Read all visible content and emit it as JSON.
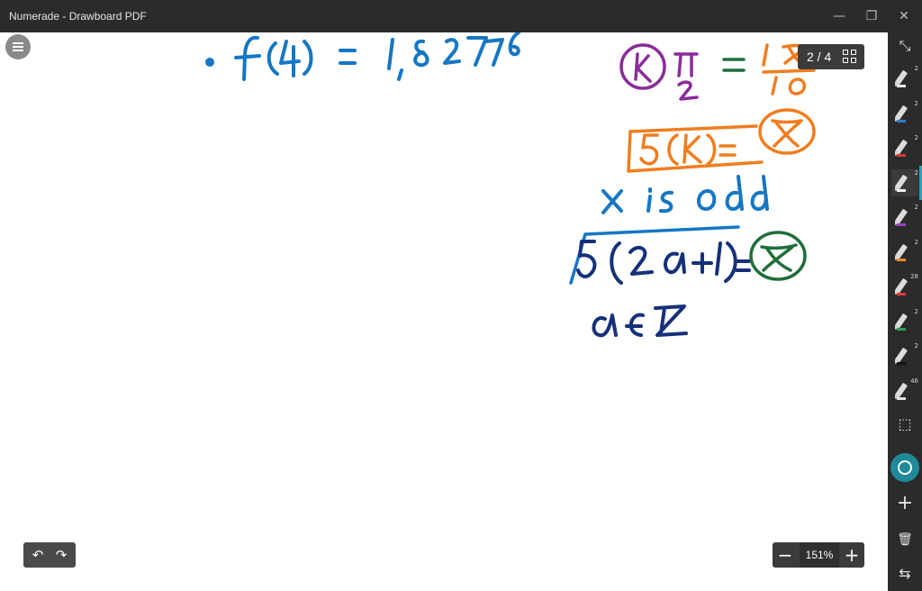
{
  "window": {
    "title": "Numerade - Drawboard PDF",
    "minimize_glyph": "—",
    "restore_glyph": "❐",
    "close_glyph": "✕"
  },
  "page_indicator": "2 / 4",
  "zoom": {
    "value": "151%",
    "minus": "−",
    "plus": "+"
  },
  "history": {
    "undo": "↶",
    "redo": "↷"
  },
  "tools": [
    {
      "name": "pen-white",
      "count": "2",
      "color": "#e8e8e8"
    },
    {
      "name": "pen-blue",
      "count": "2",
      "color": "#2e7fd0"
    },
    {
      "name": "pen-red",
      "count": "2",
      "color": "#d23b3b"
    },
    {
      "name": "pen-white-2",
      "count": "2",
      "color": "#f2f2f2"
    },
    {
      "name": "pen-purple",
      "count": "2",
      "color": "#9b3fc0"
    },
    {
      "name": "pen-orange",
      "count": "2",
      "color": "#f08a2a"
    },
    {
      "name": "pen-red-2",
      "count": "28",
      "color": "#e03a3a"
    },
    {
      "name": "pen-green",
      "count": "2",
      "color": "#2f9e55"
    },
    {
      "name": "pen-black",
      "count": "2",
      "color": "#111111"
    },
    {
      "name": "eraser",
      "count": "46",
      "color": "#e0e0e0"
    }
  ],
  "side_icons": {
    "select": "⤡",
    "lasso": "⬚",
    "add": "+",
    "delete": "🗑",
    "swap": "⇆"
  },
  "colors": {
    "ink_blue": "#1577c4",
    "ink_orange": "#f07d1f",
    "ink_purple": "#8a2c9a",
    "ink_green": "#1f6e3a",
    "ink_navy": "#16317a",
    "accent": "#1f8a9a"
  }
}
